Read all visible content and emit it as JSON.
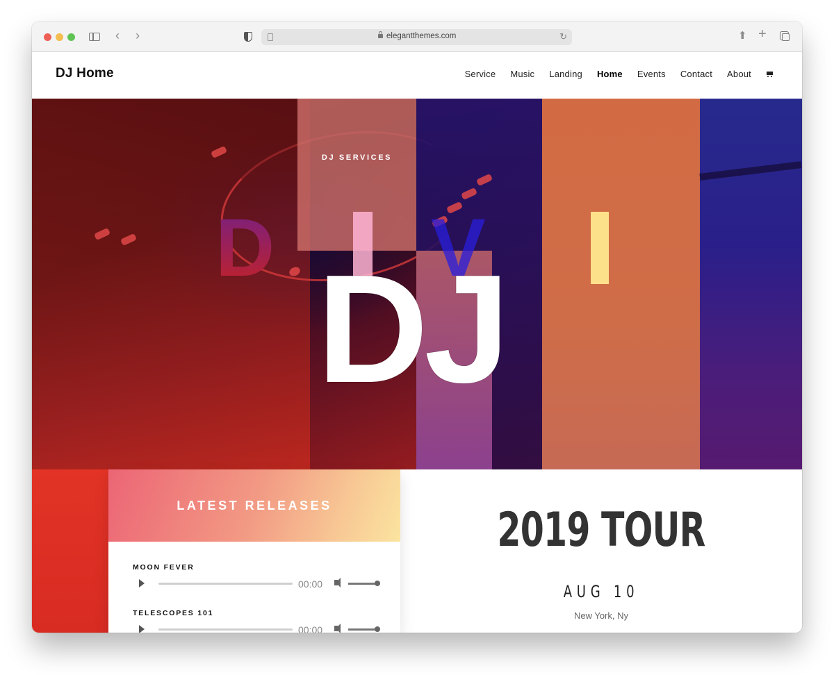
{
  "browser": {
    "url": "elegantthemes.com"
  },
  "site": {
    "logo": "DJ Home",
    "nav": [
      {
        "label": "Service",
        "active": false
      },
      {
        "label": "Music",
        "active": false
      },
      {
        "label": "Landing",
        "active": false
      },
      {
        "label": "Home",
        "active": true
      },
      {
        "label": "Events",
        "active": false
      },
      {
        "label": "Contact",
        "active": false
      },
      {
        "label": "About",
        "active": false
      }
    ],
    "cart_icon": "shopping-cart-icon"
  },
  "hero": {
    "kicker": "DJ SERVICES",
    "background_letters": [
      "D",
      "I",
      "V",
      "I"
    ],
    "title": "DJ"
  },
  "releases": {
    "title": "LATEST RELEASES",
    "tracks": [
      {
        "title": "MOON FEVER",
        "time": "00:00",
        "progress": 0,
        "volume": 1.0
      },
      {
        "title": "TELESCOPES 101",
        "time": "00:00",
        "progress": 0,
        "volume": 1.0
      }
    ]
  },
  "tour": {
    "title": "2019 TOUR",
    "date": "AUG 10",
    "location": "New York, Ny"
  },
  "colors": {
    "red_accent": "#e23326",
    "releases_gradient_start": "#ec6575",
    "releases_gradient_end": "#fbe4a0",
    "orange_panel": "#d26b44",
    "blue_panel": "#272a8c"
  }
}
